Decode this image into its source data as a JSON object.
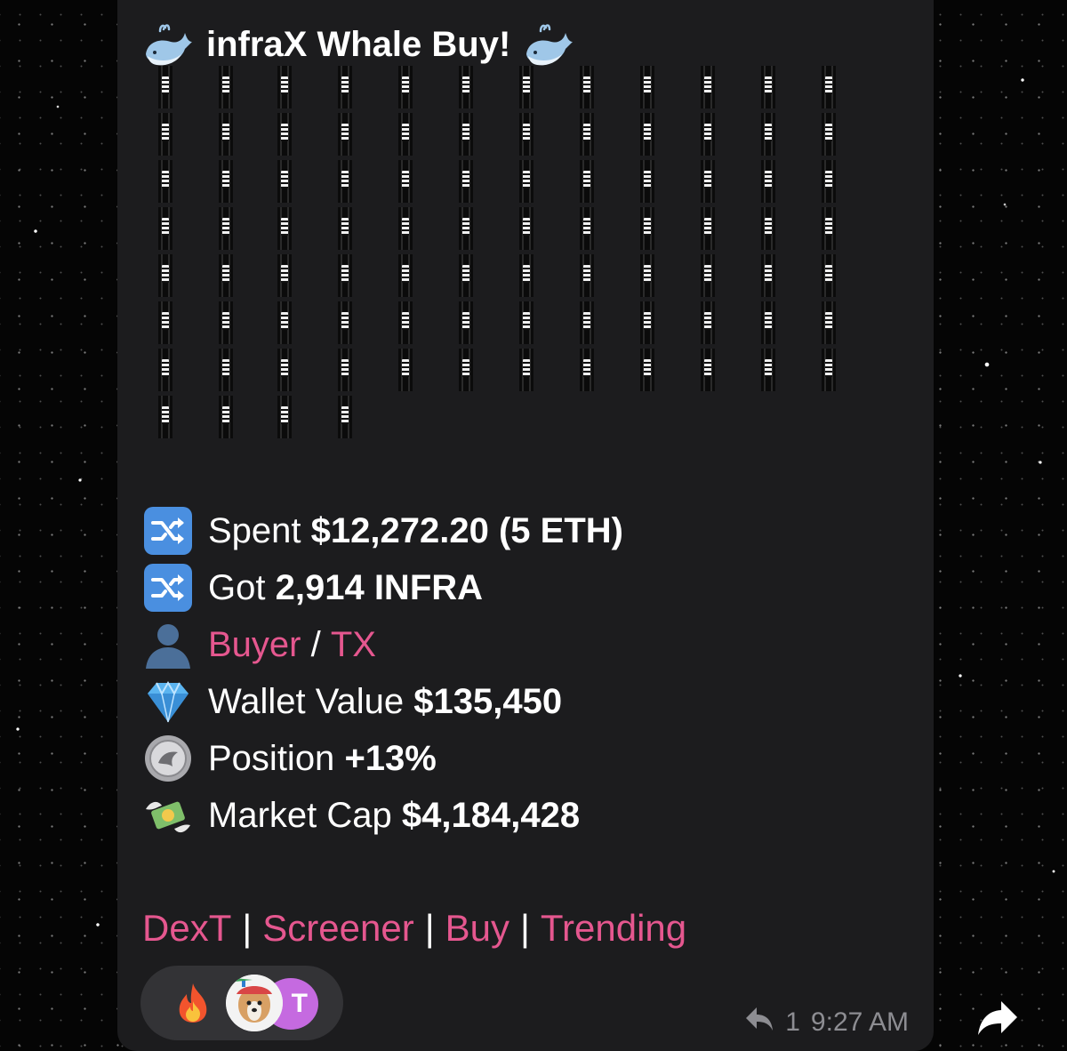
{
  "message": {
    "title": "infraX Whale Buy!",
    "title_icon": "whale-icon",
    "lines": [
      {
        "icon": "shuffle-icon",
        "label": "Spent",
        "value": "$12,272.20 (5 ETH)"
      },
      {
        "icon": "shuffle-icon",
        "label": "Got",
        "value": "2,914 INFRA"
      },
      {
        "icon": "user-icon",
        "buyer": "Buyer",
        "slash": "/",
        "tx": "TX"
      },
      {
        "icon": "diamond-icon",
        "label": "Wallet Value",
        "value": "$135,450"
      },
      {
        "icon": "coin-icon",
        "label": "Position",
        "value": "+13%"
      },
      {
        "icon": "money-wings-icon",
        "label": "Market Cap",
        "value": "$4,184,428"
      }
    ],
    "links": [
      {
        "label": "DexT"
      },
      {
        "label": "Screener"
      },
      {
        "label": "Buy"
      },
      {
        "label": "Trending"
      }
    ],
    "separator": "|",
    "reactions": {
      "emoji": "fire-icon",
      "avatar_letter": "T"
    },
    "reply_count": "1",
    "time": "9:27 AM"
  },
  "colors": {
    "link": "#e5578f",
    "bubble": "#1c1c1e",
    "meta": "#8d8d92"
  }
}
